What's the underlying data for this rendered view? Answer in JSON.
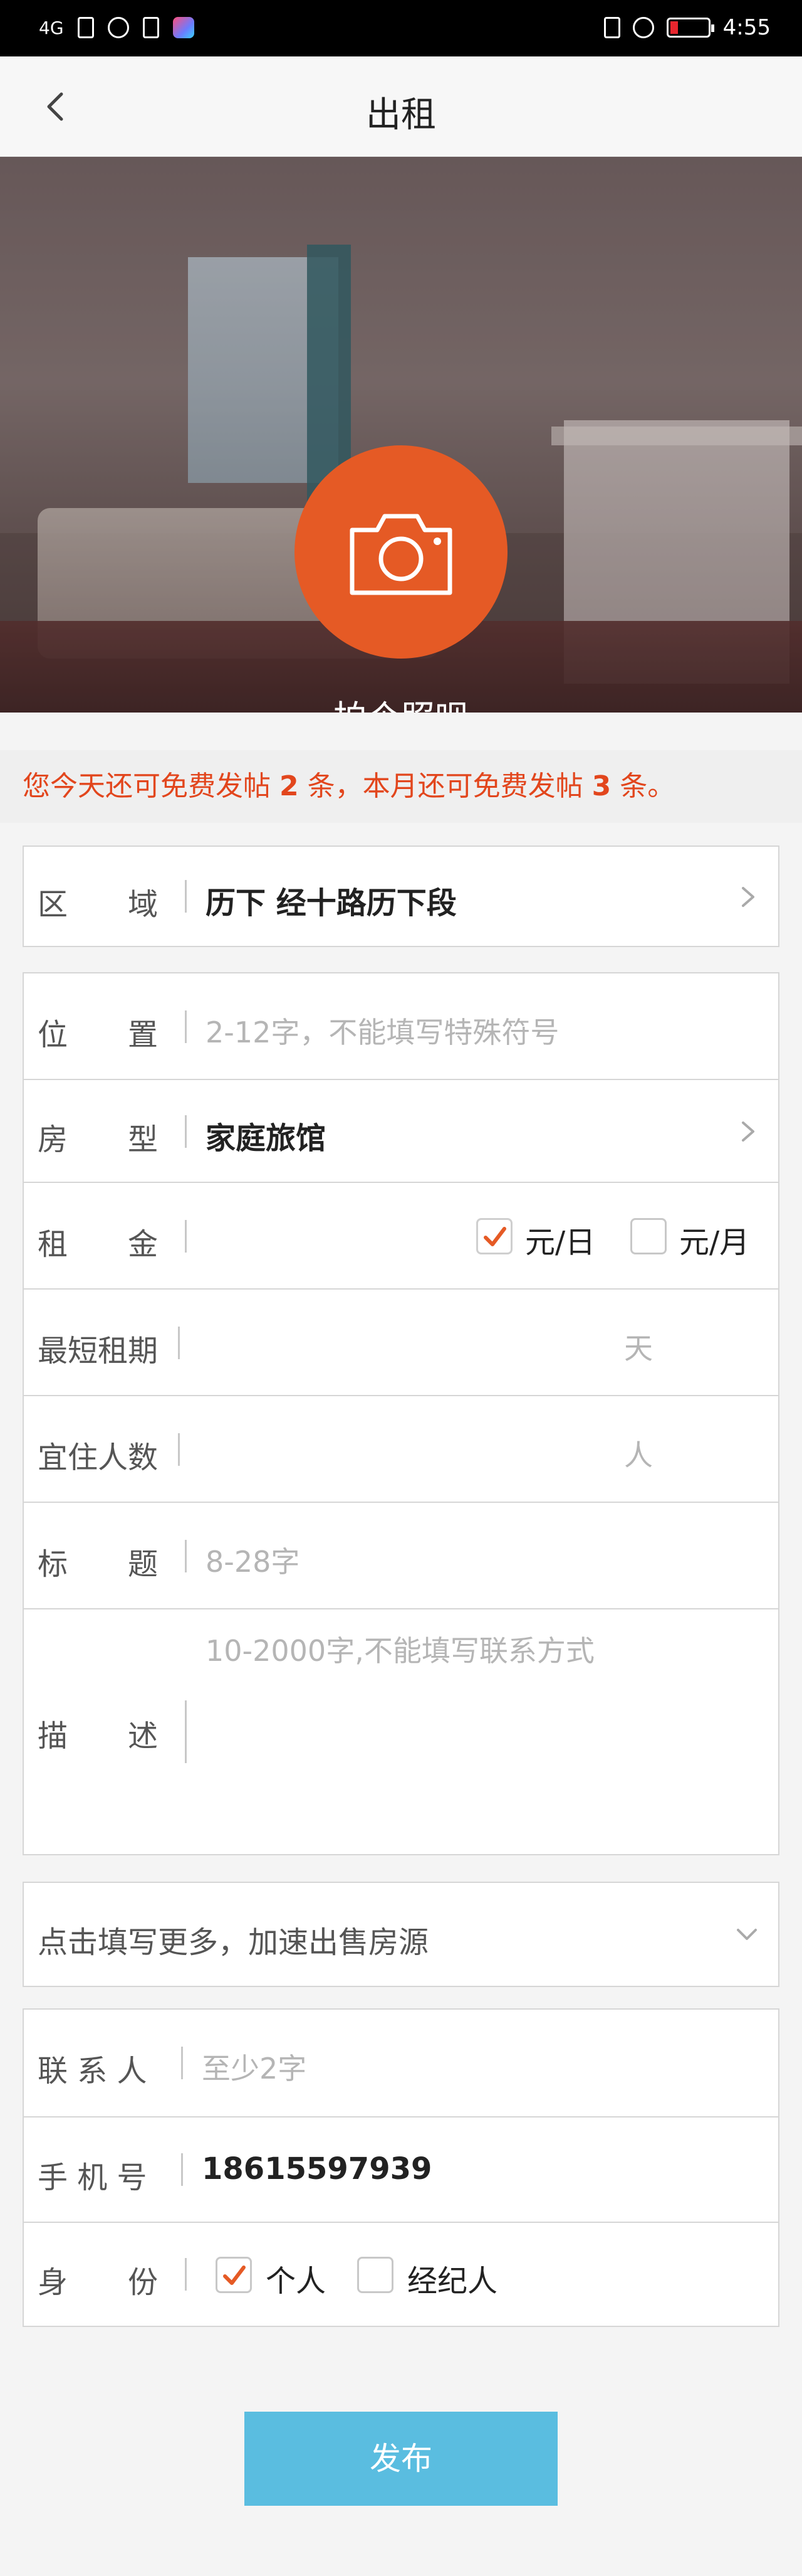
{
  "status_bar": {
    "signal": "4G",
    "time": "4:55"
  },
  "nav": {
    "title": "出租"
  },
  "banner": {
    "label": "拍个照呗"
  },
  "notice": {
    "prefix": "您今天还可免费发帖",
    "today_count": "2",
    "mid": "条，本月还可免费发帖",
    "month_count": "3",
    "suffix": "条。"
  },
  "form": {
    "area": {
      "label": "区　　域",
      "value": "历下 经十路历下段"
    },
    "location": {
      "label": "位　　置",
      "placeholder": "2-12字，不能填写特殊符号"
    },
    "room_type": {
      "label": "房　　型",
      "value": "家庭旅馆"
    },
    "rent": {
      "label": "租　　金",
      "opt_day": "元/日",
      "opt_month": "元/月",
      "day_checked": true,
      "month_checked": false
    },
    "min_term": {
      "label": "最短租期",
      "unit": "天"
    },
    "occupants": {
      "label": "宜住人数",
      "unit": "人"
    },
    "title": {
      "label": "标　　题",
      "placeholder": "8-28字"
    },
    "description": {
      "label": "描　　述",
      "placeholder": "10-2000字,不能填写联系方式"
    }
  },
  "more": {
    "label": "点击填写更多，加速出售房源"
  },
  "contact": {
    "name": {
      "label": "联 系 人",
      "placeholder": "至少2字"
    },
    "phone": {
      "label": "手 机 号",
      "value": "18615597939"
    },
    "identity": {
      "label": "身　　份",
      "opt_personal": "个人",
      "opt_agent": "经纪人",
      "personal_checked": true,
      "agent_checked": false
    }
  },
  "submit": {
    "label": "发布"
  },
  "colors": {
    "accent": "#e55a25",
    "notice": "#e2461d",
    "submit": "#5abde0"
  },
  "icons": [
    "back-arrow-icon",
    "camera-icon",
    "chevron-right-icon",
    "chevron-down-icon",
    "checkmark-icon"
  ]
}
